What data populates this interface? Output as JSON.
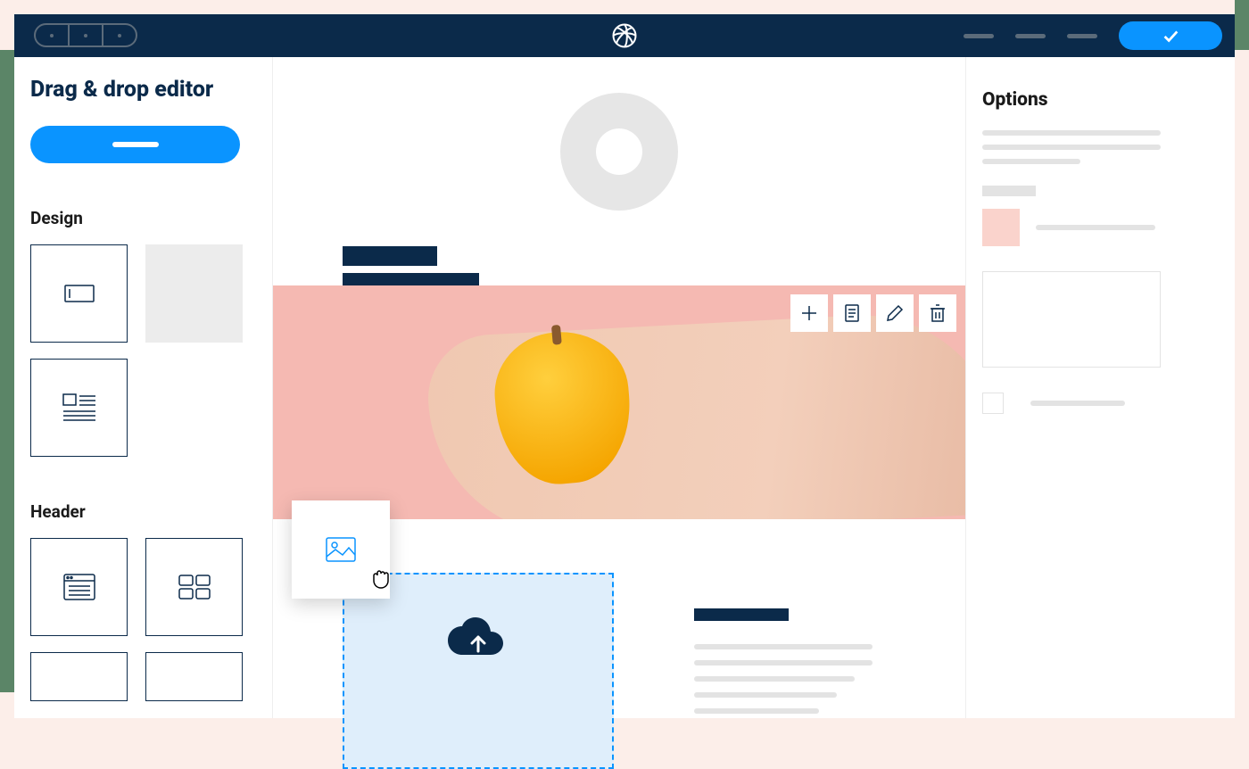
{
  "colors": {
    "accent_blue": "#0a94ff",
    "brand_navy": "#0b2a4a",
    "pink": "#fad3cc",
    "drop_blue": "#dfeefb"
  },
  "topbar": {
    "confirm_icon_name": "check-icon"
  },
  "sidebar": {
    "title": "Drag & drop editor",
    "sections": [
      {
        "label": "Design"
      },
      {
        "label": "Header"
      }
    ]
  },
  "block_toolbar": {
    "tools": [
      "add",
      "copy",
      "edit",
      "delete"
    ]
  },
  "options": {
    "title": "Options"
  }
}
